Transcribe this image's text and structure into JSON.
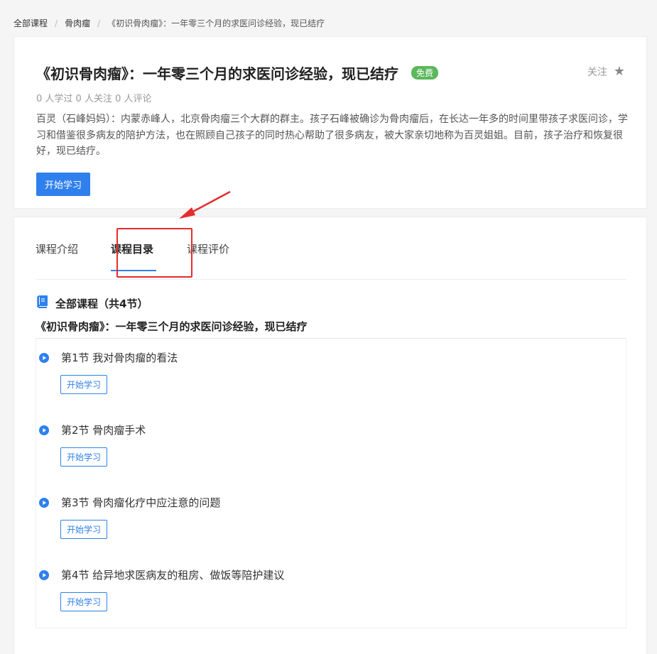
{
  "breadcrumb": {
    "items": [
      "全部课程",
      "骨肉瘤",
      "《初识骨肉瘤》：一年零三个月的求医问诊经验，现已结疗"
    ],
    "separator": "/"
  },
  "course": {
    "title": "《初识骨肉瘤》：一年零三个月的求医问诊经验，现已结疗",
    "badge": "免费",
    "follow_label": "关注",
    "stats": "0 人学过 0 人关注 0 人评论",
    "description": "百灵（石峰妈妈）：内蒙赤峰人，北京骨肉瘤三个大群的群主。孩子石峰被确诊为骨肉瘤后，在长达一年多的时间里带孩子求医问诊，学习和借鉴很多病友的陪护方法，也在照顾自己孩子的同时热心帮助了很多病友，被大家亲切地称为百灵姐姐。目前，孩子治疗和恢复很好，现已结疗。",
    "start_button": "开始学习"
  },
  "tabs": [
    {
      "label": "课程介绍",
      "active": false
    },
    {
      "label": "课程目录",
      "active": true
    },
    {
      "label": "课程评价",
      "active": false
    }
  ],
  "catalog": {
    "header": "全部课程（共4节）",
    "subtitle": "《初识骨肉瘤》：一年零三个月的求医问诊经验，现已结疗",
    "lessons": [
      {
        "title": "第1节 我对骨肉瘤的看法",
        "button": "开始学习"
      },
      {
        "title": "第2节 骨肉瘤手术",
        "button": "开始学习"
      },
      {
        "title": "第3节 骨肉瘤化疗中应注意的问题",
        "button": "开始学习"
      },
      {
        "title": "第4节 给异地求医病友的租房、做饭等陪护建议",
        "button": "开始学习"
      }
    ]
  },
  "colors": {
    "accent": "#2f80ed",
    "badge_green": "#5cb85c",
    "annotation_red": "#e52d2d"
  },
  "icons": {
    "follow": "star-icon",
    "catalog": "book-icon",
    "lesson": "play-circle-icon"
  }
}
